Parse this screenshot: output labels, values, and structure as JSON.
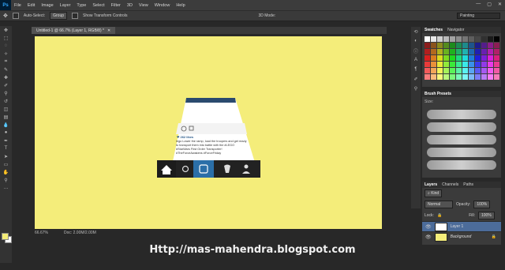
{
  "app": {
    "logo": "Ps"
  },
  "menu": [
    "File",
    "Edit",
    "Image",
    "Layer",
    "Type",
    "Select",
    "Filter",
    "3D",
    "View",
    "Window",
    "Help"
  ],
  "window_controls": [
    "—",
    "▢",
    "✕"
  ],
  "options": {
    "auto_select": "Auto-Select:",
    "group": "Group",
    "transform": "Show Transform Controls",
    "mode_3d": "3D Mode:",
    "workspace": "Painting"
  },
  "document": {
    "tab_title": "Untitled-1 @ 66.7% (Layer 1, RGB/8) *",
    "zoom": "66.67%",
    "doc_size": "Doc: 2.00M/2.00M"
  },
  "canvas": {
    "bg_color": "#f4ed7a",
    "post": {
      "likes": "❤ 262 likes",
      "caption": "lego Lower the ramp, load the troopers and get ready to transport them into battle with the #LEGO #StarWars First Order Transporter! #TheForceAwakens #ForceFriday"
    }
  },
  "panels": {
    "swatches": {
      "tab_active": "Swatches",
      "tab_other": "Navigator"
    },
    "brush_presets": {
      "title": "Brush Presets",
      "size_label": "Size:"
    },
    "layers": {
      "tabs": [
        "Layers",
        "Channels",
        "Paths"
      ],
      "kind": "⌕ Kind",
      "blend_mode": "Normal",
      "opacity_label": "Opacity:",
      "opacity_value": "100%",
      "lock_label": "Lock:",
      "fill_label": "Fill:",
      "fill_value": "100%",
      "items": [
        {
          "name": "Layer 1"
        },
        {
          "name": "Background"
        }
      ]
    }
  },
  "watermark": "Http://mas-mahendra.blogspot.com"
}
